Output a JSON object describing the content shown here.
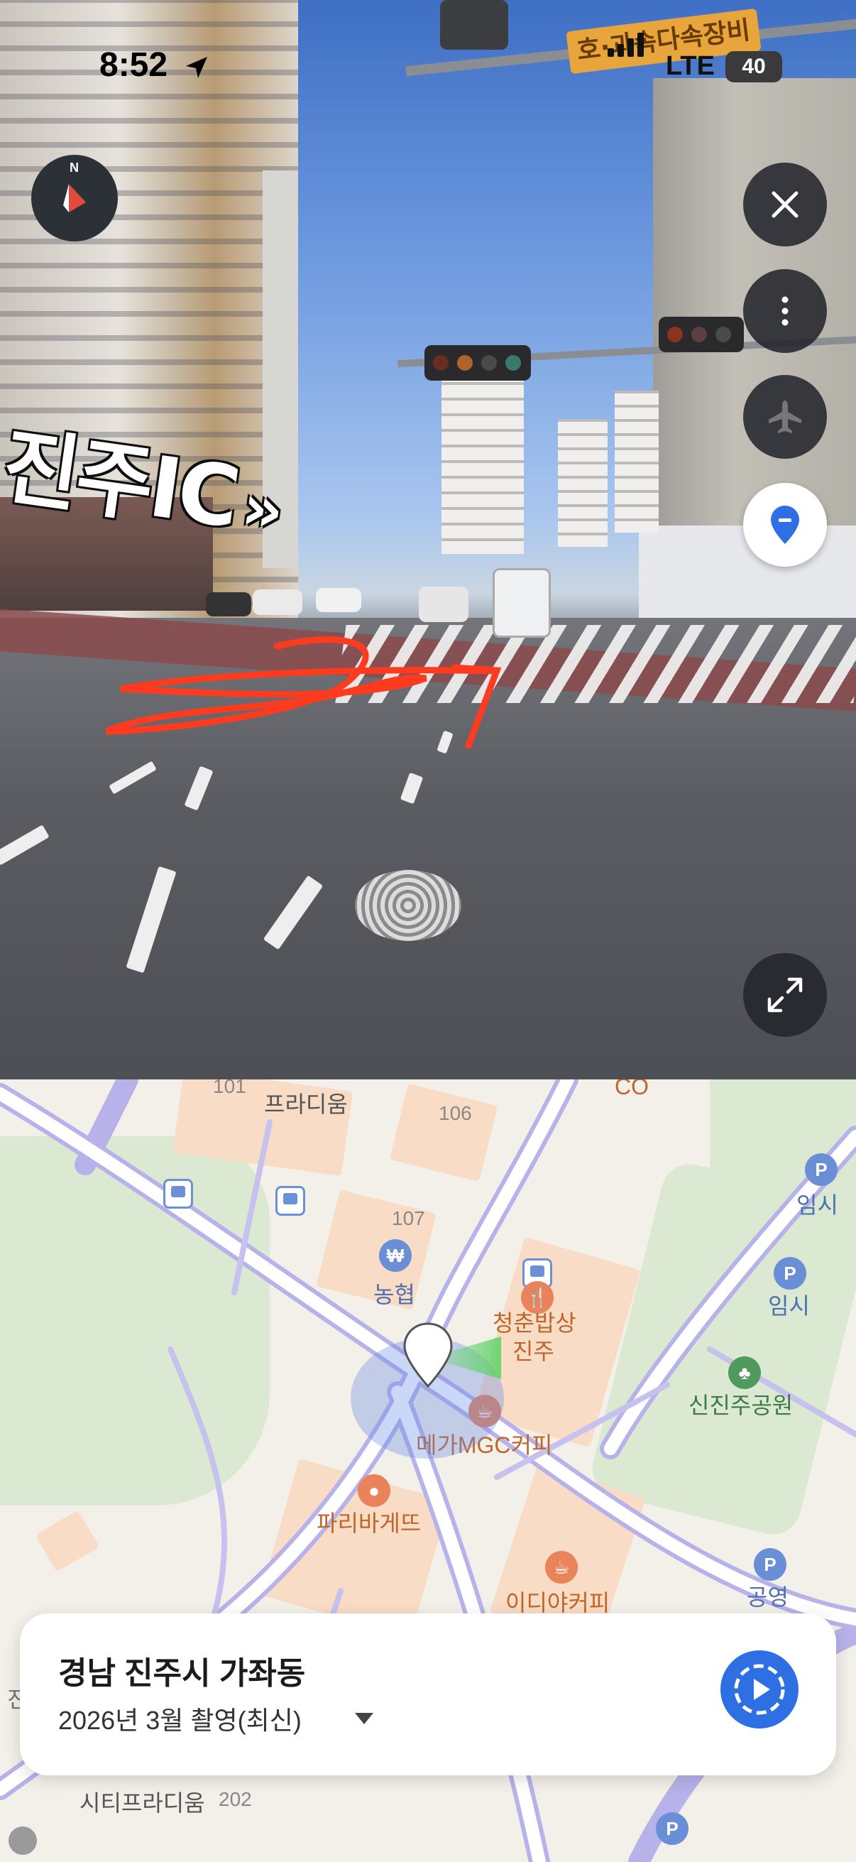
{
  "status_bar": {
    "time": "8:52",
    "network": "LTE",
    "battery": "40",
    "icons": [
      "location-arrow-icon",
      "signal-bars-icon",
      "battery-icon"
    ]
  },
  "streetview": {
    "overlay_text": "진주IC",
    "overlay_arrow": "»",
    "sign_text": "호·과속다속장비",
    "controls": {
      "compass_label": "N",
      "close_icon": "close-icon",
      "more_icon": "more-vertical-icon",
      "plane_icon": "airplane-icon",
      "pin_icon": "map-pin-icon",
      "expand_icon": "expand-icon"
    }
  },
  "map": {
    "labels": {
      "building_101": "101",
      "paradium": "프라디움",
      "building_106": "106",
      "co": "CO",
      "building_107": "107",
      "nonghyup": "농협",
      "restaurant": "청춘밥상",
      "restaurant_sub": "진주",
      "mega_coffee": "메가MGC커피",
      "paris": "파리바게뜨",
      "ediya": "이디야커피",
      "park": "신진주공원",
      "parking1": "임시",
      "parking2": "임시",
      "parking3": "공영",
      "city_paradium": "시티프라디움",
      "city_num": "202",
      "left_edge": "진"
    }
  },
  "card": {
    "title": "경남 진주시 가좌동",
    "subtitle": "2026년 3월 촬영(최신)",
    "play_icon": "play-history-icon"
  },
  "colors": {
    "accent": "#2f6fe4",
    "road_purple": "#b8b2ea",
    "park_green": "#dbe9d2",
    "building_peach": "#f8dcc6",
    "poi_orange": "#e8835a",
    "overlay_red": "#ff3b1f"
  }
}
